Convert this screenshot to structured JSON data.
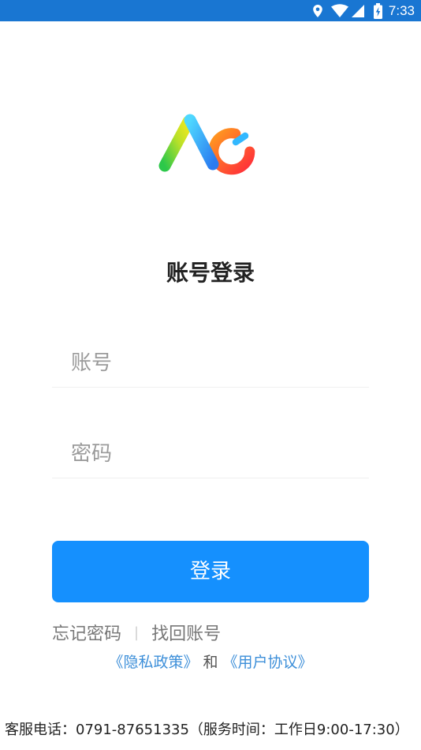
{
  "status_bar": {
    "time": "7:33",
    "icons": [
      "location-icon",
      "wifi-icon",
      "signal-icon",
      "battery-icon"
    ],
    "background_color": "#1976d2"
  },
  "logo": {
    "icon": "app-logo-icon"
  },
  "login": {
    "title": "账号登录",
    "account_placeholder": "账号",
    "password_placeholder": "密码",
    "login_button": "登录",
    "button_color": "#1590fe"
  },
  "links": {
    "forgot_password": "忘记密码",
    "divider": "|",
    "recover_account": "找回账号"
  },
  "agreement": {
    "privacy_policy": "《隐私政策》",
    "and": "和",
    "user_agreement": "《用户协议》",
    "link_color": "#3d8fd9"
  },
  "footer": {
    "service_info": "客服电话：0791-87651335（服务时间：工作日9:00-17:30）"
  }
}
